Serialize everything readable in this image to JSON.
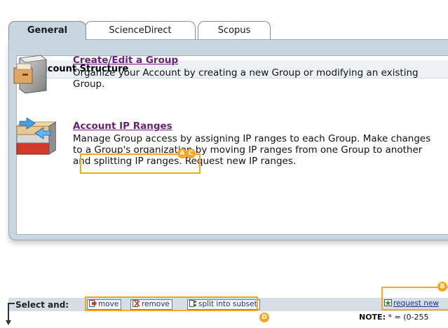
{
  "tabs": [
    {
      "label": "General",
      "active": true
    },
    {
      "label": "ScienceDirect",
      "active": false
    },
    {
      "label": "Scopus",
      "active": false
    }
  ],
  "section": {
    "title": "Account Structure",
    "icon": "red-arrow-icon"
  },
  "features": [
    {
      "title": "Create/Edit a Group",
      "description": "Organize your Account by creating a new Group or modifying an existing Group.",
      "icon": "file-cabinet-icon"
    },
    {
      "title": "Account IP Ranges",
      "description": "Manage Group access by assigning IP ranges to each Group. Make changes to a Group's organization by moving IP ranges from one Group to another and splitting IP ranges.  Request new IP ranges.",
      "icon": "stacked-blocks-arrows-icon"
    }
  ],
  "badges": {
    "a": "A",
    "b": "B",
    "c": "C",
    "d": "D"
  },
  "toolbar": {
    "select_label": "Select and:",
    "move_label": "move",
    "remove_label": "remove",
    "split_label": "split into subset",
    "request_label": "request new"
  },
  "note": {
    "label": "NOTE:",
    "text": " * = (0-255"
  },
  "colors": {
    "panel": "#c7d6e1",
    "highlight": "#f5a623",
    "link": "#6a1f7b",
    "toolbar": "#d7dfe6"
  }
}
